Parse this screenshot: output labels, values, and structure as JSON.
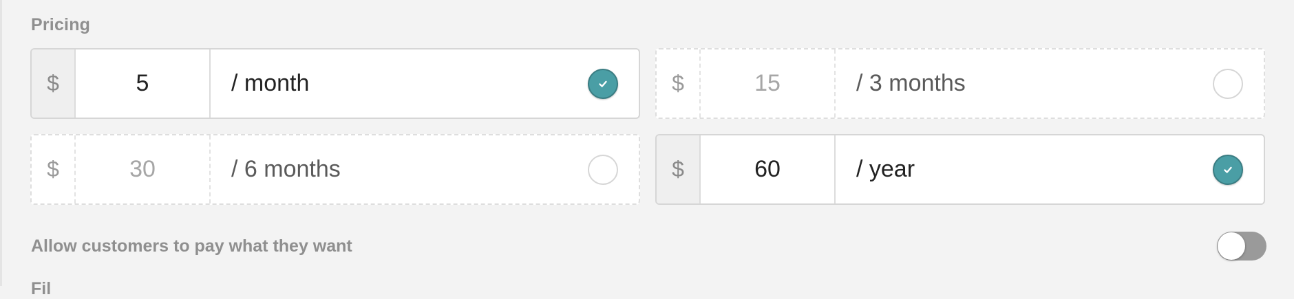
{
  "pricing": {
    "section_title": "Pricing",
    "options": [
      {
        "currency": "$",
        "amount": "5",
        "period": "/ month",
        "enabled": true
      },
      {
        "currency": "$",
        "amount": "15",
        "period": "/ 3 months",
        "enabled": false
      },
      {
        "currency": "$",
        "amount": "30",
        "period": "/ 6 months",
        "enabled": false
      },
      {
        "currency": "$",
        "amount": "60",
        "period": "/ year",
        "enabled": true
      }
    ]
  },
  "pay_what_you_want": {
    "label": "Allow customers to pay what they want",
    "enabled": false
  },
  "next_section": {
    "title": "Fil"
  },
  "colors": {
    "accent": "#4a9ea5",
    "background": "#f3f3f3",
    "muted_text": "#8f8f8f"
  },
  "icons": {
    "checked": "check-icon"
  }
}
